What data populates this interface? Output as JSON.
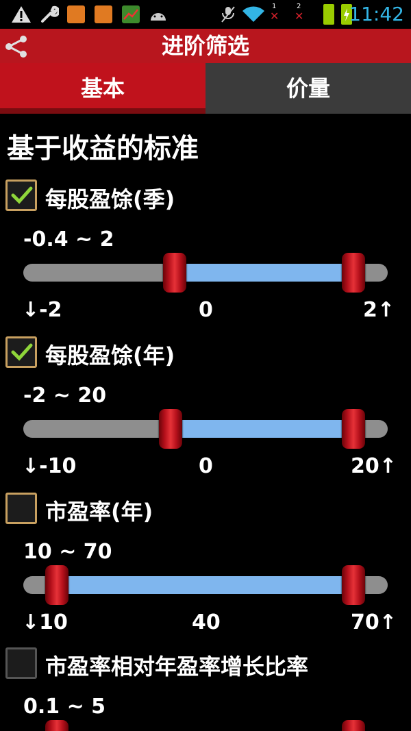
{
  "status_bar": {
    "time": "11:42",
    "icons": [
      "warning-icon",
      "wrench-icon",
      "app-icon",
      "app-icon",
      "chart-icon",
      "android-icon",
      "mute-icon",
      "wifi-icon",
      "signal-1-icon",
      "signal-2-icon",
      "battery-icon",
      "battery-charging-icon"
    ],
    "sim1_label": "1",
    "sim2_label": "2"
  },
  "header": {
    "title": "进阶筛选",
    "share_icon": "share-icon"
  },
  "tabs": [
    {
      "label": "基本",
      "active": true
    },
    {
      "label": "价量",
      "active": false
    }
  ],
  "section": {
    "heading": "基于收益的标准"
  },
  "criteria": [
    {
      "label": "每股盈馀(季)",
      "checked": true,
      "range_text": "-0.4 ~ 2",
      "min_label": "↓-2",
      "mid_label": "0",
      "max_label": "2↑",
      "min": -2,
      "max": 2,
      "low": -0.4,
      "high": 2
    },
    {
      "label": "每股盈馀(年)",
      "checked": true,
      "range_text": "-2 ~ 20",
      "min_label": "↓-10",
      "mid_label": "0",
      "max_label": "20↑",
      "min": -10,
      "max": 20,
      "low": -2,
      "high": 20
    },
    {
      "label": "市盈率(年)",
      "checked": false,
      "range_text": "10 ~ 70",
      "min_label": "↓10",
      "mid_label": "40",
      "max_label": "70↑",
      "min": 10,
      "max": 70,
      "low": 10,
      "high": 70
    },
    {
      "label": "市盈率相对年盈率增长比率",
      "checked": false,
      "range_text": "0.1 ~ 5"
    }
  ],
  "colors": {
    "title_bar": "#b8161e",
    "active_tab": "#c0121c",
    "inactive_tab": "#3b3b3b",
    "track": "#8e8e8e",
    "track_fill": "#7fb6ee",
    "time": "#33b5e5"
  }
}
